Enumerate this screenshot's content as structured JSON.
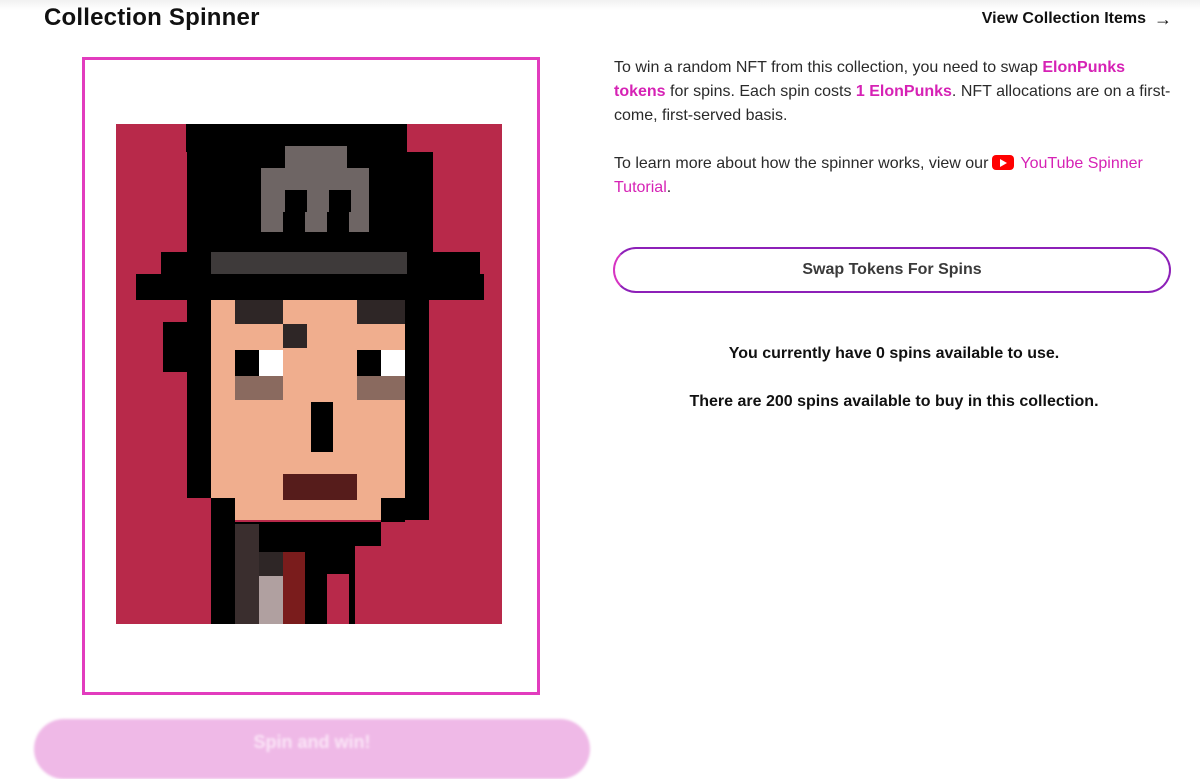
{
  "header": {
    "title": "Collection Spinner",
    "view_link": "View Collection Items"
  },
  "info": {
    "intro_prefix": "To win a random NFT from this collection, you need to swap",
    "token_name": "ElonPunks tokens",
    "mid": " for spins. Each spin costs ",
    "cost": "1 ElonPunks",
    "suffix": ". NFT allocations are on a first-come, first-served basis.",
    "learn_prefix": "To learn more about how the spinner works, view our",
    "tutorial_link": "YouTube Spinner Tutorial",
    "learn_suffix": "."
  },
  "swap_button": "Swap Tokens For Spins",
  "status": {
    "spins_have": "You currently have 0 spins available to use.",
    "spins_buy": "There are 200 spins available to buy in this collection."
  },
  "spin_button": "Spin and win!",
  "nft_image": {
    "subject": "pixel-art punk with black bowler hat and skull emblem",
    "colors": {
      "background": "#b8294a",
      "outline": "#000000",
      "skin": "#f0ae8e",
      "hat_grey": "#6e6564",
      "mouth": "#561c1b",
      "tie": "#7a1c1c"
    }
  }
}
